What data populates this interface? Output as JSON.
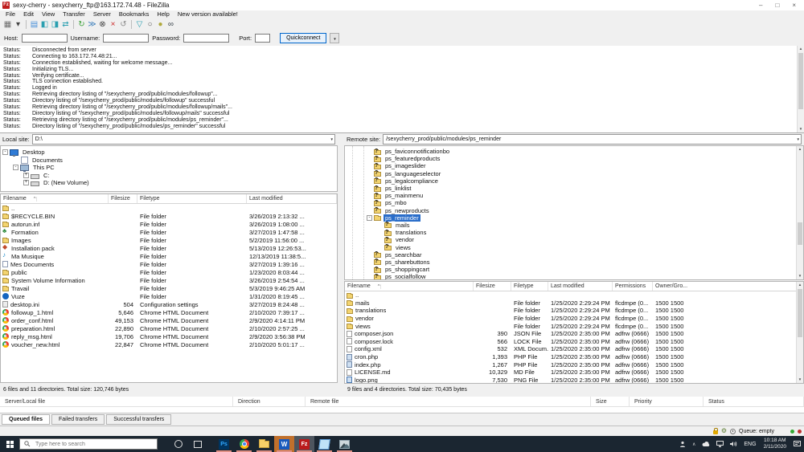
{
  "window": {
    "title": "sexy-cherry - sexycherry_ftp@163.172.74.48 - FileZilla",
    "app_icon": "Fz",
    "minimize": "–",
    "maximize": "□",
    "close": "×"
  },
  "menu": {
    "items": [
      "File",
      "Edit",
      "View",
      "Transfer",
      "Server",
      "Bookmarks",
      "Help",
      "New version available!"
    ]
  },
  "toolbar": {
    "icons": [
      {
        "name": "site-manager",
        "glyph": "▦",
        "color": "#6e6e6e"
      },
      {
        "name": "site-manager-dropdown",
        "glyph": "▾",
        "color": "#444444"
      },
      {
        "sep": true
      },
      {
        "name": "toggle-log",
        "glyph": "▤",
        "color": "#4a90d9"
      },
      {
        "name": "toggle-local-tree",
        "glyph": "◧",
        "color": "#2a9fb0"
      },
      {
        "name": "toggle-remote-tree",
        "glyph": "◨",
        "color": "#2a9fb0"
      },
      {
        "name": "toggle-queue",
        "glyph": "⇄",
        "color": "#2a9fb0"
      },
      {
        "sep": true
      },
      {
        "name": "refresh",
        "glyph": "↻",
        "color": "#3fa23c"
      },
      {
        "name": "process-queue",
        "glyph": "≫",
        "color": "#3a7dbb"
      },
      {
        "name": "cancel",
        "glyph": "⊗",
        "color": "#3c3c3c"
      },
      {
        "name": "disconnect",
        "glyph": "×",
        "color": "#cc2a2a"
      },
      {
        "name": "reconnect",
        "glyph": "↺",
        "color": "#8a8a8a"
      },
      {
        "sep": true
      },
      {
        "name": "filter",
        "glyph": "▽",
        "color": "#2a9fb0"
      },
      {
        "name": "compare",
        "glyph": "○",
        "color": "#555555"
      },
      {
        "name": "sync-browse",
        "glyph": "●",
        "color": "#b0a93c"
      },
      {
        "name": "find-files",
        "glyph": "∞",
        "color": "#39424a"
      }
    ]
  },
  "quickconnect": {
    "host_label": "Host:",
    "username_label": "Username:",
    "password_label": "Password:",
    "port_label": "Port:",
    "button_label": "Quickconnect",
    "dropdown_glyph": "▼"
  },
  "log": {
    "entries": [
      {
        "type": "Status:",
        "message": "Disconnected from server"
      },
      {
        "type": "Status:",
        "message": "Connecting to 163.172.74.48:21..."
      },
      {
        "type": "Status:",
        "message": "Connection established, waiting for welcome message..."
      },
      {
        "type": "Status:",
        "message": "Initializing TLS..."
      },
      {
        "type": "Status:",
        "message": "Verifying certificate..."
      },
      {
        "type": "Status:",
        "message": "TLS connection established."
      },
      {
        "type": "Status:",
        "message": "Logged in"
      },
      {
        "type": "Status:",
        "message": "Retrieving directory listing of \"/sexycherry_prod/public/modules/followup\"..."
      },
      {
        "type": "Status:",
        "message": "Directory listing of \"/sexycherry_prod/public/modules/followup\" successful"
      },
      {
        "type": "Status:",
        "message": "Retrieving directory listing of \"/sexycherry_prod/public/modules/followup/mails\"..."
      },
      {
        "type": "Status:",
        "message": "Directory listing of \"/sexycherry_prod/public/modules/followup/mails\" successful"
      },
      {
        "type": "Status:",
        "message": "Retrieving directory listing of \"/sexycherry_prod/public/modules/ps_reminder\"..."
      },
      {
        "type": "Status:",
        "message": "Directory listing of \"/sexycherry_prod/public/modules/ps_reminder\" successful"
      }
    ]
  },
  "local": {
    "label": "Local site:",
    "path": "D:\\",
    "tree": [
      {
        "label": "Desktop",
        "indent": 0,
        "expander": "-",
        "icon": "desktop"
      },
      {
        "label": "Documents",
        "indent": 1,
        "icon": "docs"
      },
      {
        "label": "This PC",
        "indent": 1,
        "expander": "-",
        "icon": "pc"
      },
      {
        "label": "C:",
        "indent": 2,
        "expander": "+",
        "icon": "drive"
      },
      {
        "label": "D: (New Volume)",
        "indent": 2,
        "expander": "+",
        "icon": "drive"
      }
    ],
    "columns": [
      "Filename",
      "Filesize",
      "Filetype",
      "Last modified"
    ],
    "files": [
      {
        "name": "..",
        "icon": "folder",
        "size": "",
        "type": "",
        "modified": ""
      },
      {
        "name": "$RECYCLE.BIN",
        "icon": "folder",
        "size": "",
        "type": "File folder",
        "modified": "3/26/2019 2:13:32 ..."
      },
      {
        "name": "autorun.inf",
        "icon": "folder",
        "size": "",
        "type": "File folder",
        "modified": "3/26/2019 1:08:00 ..."
      },
      {
        "name": "Formation",
        "icon": "tree",
        "size": "",
        "type": "File folder",
        "modified": "3/27/2019 1:47:58 ..."
      },
      {
        "name": "Images",
        "icon": "folder",
        "size": "",
        "type": "File folder",
        "modified": "5/2/2019 11:56:00 ..."
      },
      {
        "name": "Installation pack",
        "icon": "pack",
        "size": "",
        "type": "File folder",
        "modified": "5/13/2019 12:26:53..."
      },
      {
        "name": "Ma Musique",
        "icon": "music",
        "size": "",
        "type": "File folder",
        "modified": "12/13/2019 11:38:5..."
      },
      {
        "name": "Mes Documents",
        "icon": "docs",
        "size": "",
        "type": "File folder",
        "modified": "3/27/2019 1:39:16 ..."
      },
      {
        "name": "public",
        "icon": "folder",
        "size": "",
        "type": "File folder",
        "modified": "1/23/2020 8:03:44 ..."
      },
      {
        "name": "System Volume Information",
        "icon": "folder",
        "size": "",
        "type": "File folder",
        "modified": "3/26/2019 2:54:54 ..."
      },
      {
        "name": "Travail",
        "icon": "folder",
        "size": "",
        "type": "File folder",
        "modified": "5/3/2019 9:46:25 AM"
      },
      {
        "name": "Vuze",
        "icon": "vuze",
        "size": "",
        "type": "File folder",
        "modified": "1/31/2020 8:19:45 ..."
      },
      {
        "name": "desktop.ini",
        "icon": "config",
        "size": "504",
        "type": "Configuration settings",
        "modified": "3/27/2019 8:24:48 ..."
      },
      {
        "name": "followup_1.html",
        "icon": "chrome",
        "size": "5,646",
        "type": "Chrome HTML Document",
        "modified": "2/10/2020 7:39:17 ..."
      },
      {
        "name": "order_conf.html",
        "icon": "chrome",
        "size": "49,153",
        "type": "Chrome HTML Document",
        "modified": "2/9/2020 4:14:11 PM"
      },
      {
        "name": "preparation.html",
        "icon": "chrome",
        "size": "22,890",
        "type": "Chrome HTML Document",
        "modified": "2/10/2020 2:57:25 ..."
      },
      {
        "name": "reply_msg.html",
        "icon": "chrome",
        "size": "19,706",
        "type": "Chrome HTML Document",
        "modified": "2/9/2020 3:56:38 PM"
      },
      {
        "name": "voucher_new.html",
        "icon": "chrome",
        "size": "22,847",
        "type": "Chrome HTML Document",
        "modified": "2/10/2020 5:01:17 ..."
      }
    ],
    "status": "6 files and 11 directories. Total size: 120,746 bytes"
  },
  "remote": {
    "label": "Remote site:",
    "path": "/sexycherry_prod/public/modules/ps_reminder",
    "tree": [
      {
        "label": "ps_faviconnotificationbo",
        "indent": 0,
        "icon": "folder",
        "q": true
      },
      {
        "label": "ps_featuredproducts",
        "indent": 0,
        "icon": "folder",
        "q": true
      },
      {
        "label": "ps_imageslider",
        "indent": 0,
        "icon": "folder",
        "q": true
      },
      {
        "label": "ps_languageselector",
        "indent": 0,
        "icon": "folder",
        "q": true
      },
      {
        "label": "ps_legalcompliance",
        "indent": 0,
        "icon": "folder",
        "q": true
      },
      {
        "label": "ps_linklist",
        "indent": 0,
        "icon": "folder",
        "q": true
      },
      {
        "label": "ps_mainmenu",
        "indent": 0,
        "icon": "folder",
        "q": true
      },
      {
        "label": "ps_mbo",
        "indent": 0,
        "icon": "folder",
        "q": true
      },
      {
        "label": "ps_newproducts",
        "indent": 0,
        "icon": "folder",
        "q": true
      },
      {
        "label": "ps_reminder",
        "indent": 0,
        "expander": "-",
        "icon": "folder",
        "selected": true
      },
      {
        "label": "mails",
        "indent": 1,
        "icon": "folder",
        "q": true
      },
      {
        "label": "translations",
        "indent": 1,
        "icon": "folder",
        "q": true
      },
      {
        "label": "vendor",
        "indent": 1,
        "icon": "folder",
        "q": true
      },
      {
        "label": "views",
        "indent": 1,
        "icon": "folder",
        "q": true
      },
      {
        "label": "ps_searchbar",
        "indent": 0,
        "icon": "folder",
        "q": true
      },
      {
        "label": "ps_sharebuttons",
        "indent": 0,
        "icon": "folder",
        "q": true
      },
      {
        "label": "ps_shoppingcart",
        "indent": 0,
        "icon": "folder",
        "q": true
      },
      {
        "label": "ps_socialfollow",
        "indent": 0,
        "icon": "folder",
        "q": true
      }
    ],
    "columns": [
      "Filename",
      "Filesize",
      "Filetype",
      "Last modified",
      "Permissions",
      "Owner/Gro..."
    ],
    "files": [
      {
        "name": "..",
        "icon": "folder",
        "size": "",
        "type": "",
        "modified": "",
        "perms": "",
        "owner": ""
      },
      {
        "name": "mails",
        "icon": "folder",
        "size": "",
        "type": "File folder",
        "modified": "1/25/2020 2:29:24 PM",
        "perms": "flcdmpe (0...",
        "owner": "1500 1500"
      },
      {
        "name": "translations",
        "icon": "folder",
        "size": "",
        "type": "File folder",
        "modified": "1/25/2020 2:29:24 PM",
        "perms": "flcdmpe (0...",
        "owner": "1500 1500"
      },
      {
        "name": "vendor",
        "icon": "folder",
        "size": "",
        "type": "File folder",
        "modified": "1/25/2020 2:29:24 PM",
        "perms": "flcdmpe (0...",
        "owner": "1500 1500"
      },
      {
        "name": "views",
        "icon": "folder",
        "size": "",
        "type": "File folder",
        "modified": "1/25/2020 2:29:24 PM",
        "perms": "flcdmpe (0...",
        "owner": "1500 1500"
      },
      {
        "name": "composer.json",
        "icon": "file",
        "size": "390",
        "type": "JSON File",
        "modified": "1/25/2020 2:35:00 PM",
        "perms": "adfrw (0666)",
        "owner": "1500 1500"
      },
      {
        "name": "composer.lock",
        "icon": "file",
        "size": "566",
        "type": "LOCK File",
        "modified": "1/25/2020 2:35:00 PM",
        "perms": "adfrw (0666)",
        "owner": "1500 1500"
      },
      {
        "name": "config.xml",
        "icon": "file",
        "size": "532",
        "type": "XML Docum...",
        "modified": "1/25/2020 2:35:00 PM",
        "perms": "adfrw (0666)",
        "owner": "1500 1500"
      },
      {
        "name": "cron.php",
        "icon": "php",
        "size": "1,393",
        "type": "PHP File",
        "modified": "1/25/2020 2:35:00 PM",
        "perms": "adfrw (0666)",
        "owner": "1500 1500"
      },
      {
        "name": "index.php",
        "icon": "php",
        "size": "1,267",
        "type": "PHP File",
        "modified": "1/25/2020 2:35:00 PM",
        "perms": "adfrw (0666)",
        "owner": "1500 1500"
      },
      {
        "name": "LICENSE.md",
        "icon": "file",
        "size": "10,329",
        "type": "MD File",
        "modified": "1/25/2020 2:35:00 PM",
        "perms": "adfrw (0666)",
        "owner": "1500 1500"
      },
      {
        "name": "logo.png",
        "icon": "image",
        "size": "7,530",
        "type": "PNG File",
        "modified": "1/25/2020 2:35:00 PM",
        "perms": "adfrw (0666)",
        "owner": "1500 1500"
      }
    ],
    "status": "9 files and 4 directories. Total size: 70,435 bytes"
  },
  "queue": {
    "columns": [
      "Server/Local file",
      "Direction",
      "Remote file",
      "Size",
      "Priority",
      "Status"
    ],
    "tabs": [
      {
        "label": "Queued files",
        "active": true
      },
      {
        "label": "Failed transfers",
        "active": false
      },
      {
        "label": "Successful transfers",
        "active": false
      }
    ]
  },
  "status_bar": {
    "queue_text": "Queue: empty"
  },
  "taskbar": {
    "search_placeholder": "Type here to search",
    "apps": [
      {
        "name": "photoshop",
        "glyph": "Ps"
      },
      {
        "name": "chrome"
      },
      {
        "name": "file-explorer"
      },
      {
        "name": "word",
        "glyph": "W",
        "state": "attention"
      },
      {
        "name": "filezilla",
        "glyph": "Fz",
        "state": "active"
      },
      {
        "name": "notes"
      },
      {
        "name": "photos"
      }
    ],
    "tray": {
      "language": "ENG",
      "time": "10:18 AM",
      "date": "2/11/2020"
    }
  }
}
